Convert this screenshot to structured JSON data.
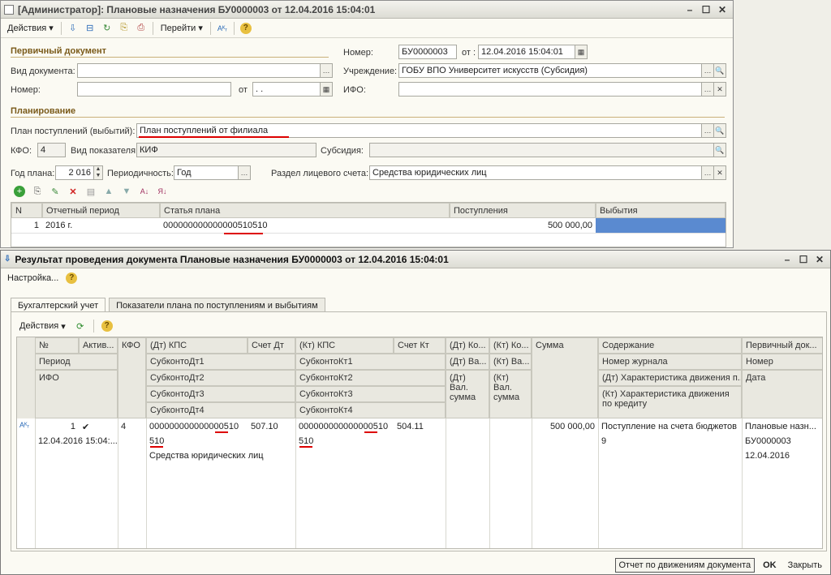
{
  "window1": {
    "title": "[Администратор]: Плановые назначения БУ0000003 от 12.04.2016 15:04:01",
    "toolbar": {
      "actions": "Действия",
      "goto": "Перейти"
    },
    "primary_section": "Первичный документ",
    "doc_type_label": "Вид документа:",
    "doc_type_value": "",
    "number_label": "Номер:",
    "number_value": "",
    "from_label": "от",
    "from_value": " .  . ",
    "header_number_label": "Номер:",
    "header_number_value": "БУ0000003",
    "header_from_label": "от :",
    "header_date_value": "12.04.2016 15:04:01",
    "institution_label": "Учреждение:",
    "institution_value": "ГОБУ ВПО Университет искусств (Субсидия)",
    "ifo_label": "ИФО:",
    "ifo_value": "",
    "planning_section": "Планирование",
    "plan_label": "План поступлений (выбытий):",
    "plan_value": "План поступлений от филиала",
    "kfo_label": "КФО:",
    "kfo_value": "4",
    "indicator_label": "Вид показателя:",
    "indicator_value": "КИФ",
    "subsidy_label": "Субсидия:",
    "subsidy_value": "",
    "year_label": "Год плана:",
    "year_value": "2 016",
    "periodicity_label": "Периодичность:",
    "periodicity_value": "Год",
    "account_section_label": "Раздел лицевого счета:",
    "account_section_value": "Средства юридических лиц",
    "table": {
      "headers": [
        "N",
        "Отчетный период",
        "Статья плана",
        "Поступления",
        "Выбытия"
      ],
      "rows": [
        [
          "1",
          "2016 г.",
          "000000000000000510510",
          "500 000,00",
          ""
        ]
      ]
    }
  },
  "window2": {
    "title": "Результат проведения документа Плановые назначения БУ0000003 от 12.04.2016 15:04:01",
    "settings": "Настройка...",
    "tabs": [
      "Бухгалтерский учет",
      "Показатели плана по поступлениям и выбытиям"
    ],
    "toolbar_actions": "Действия",
    "grid_headers": {
      "c1": [
        "№",
        "Период",
        "ИФО"
      ],
      "c2": "Актив...",
      "c3": "КФО",
      "c4": [
        "(Дт) КПС",
        "СубконтоДт1",
        "СубконтоДт2",
        "СубконтоДт3",
        "СубконтоДт4"
      ],
      "c5": "Счет Дт",
      "c6": [
        "(Кт) КПС",
        "СубконтоКт1",
        "СубконтоКт2",
        "СубконтоКт3",
        "СубконтоКт4"
      ],
      "c7": "Счет Кт",
      "c8": [
        "(Дт) Ко...",
        "(Дт) Ва...",
        "(Дт) Вал. сумма"
      ],
      "c9": [
        "(Кт) Ко...",
        "(Кт) Ва...",
        "(Кт) Вал. сумма"
      ],
      "c10": "Сумма",
      "c11": [
        "Содержание",
        "Номер журнала",
        "(Дт) Характеристика движения п...",
        "(Кт) Характеристика движения по кредиту"
      ],
      "c12": [
        "Первичный док...",
        "Номер",
        "Дата"
      ]
    },
    "row": {
      "num": "1",
      "period": "12.04.2016 15:04:...",
      "active": "✔",
      "kfo": "4",
      "dt_kps": "000000000000000510",
      "dt_kps2": "510",
      "dt_sub": "Средства юридических лиц",
      "account_dt": "507.10",
      "kt_kps": "000000000000000510",
      "kt_kps2": "510",
      "account_kt": "504.11",
      "sum": "500 000,00",
      "content": "Поступление на счета бюджетов",
      "journal": "9",
      "primary_doc": "Плановые назн...",
      "primary_num": "БУ0000003",
      "primary_date": "12.04.2016"
    },
    "bottom": {
      "report": "Отчет по движениям документа",
      "ok": "OK",
      "close": "Закрыть"
    }
  }
}
